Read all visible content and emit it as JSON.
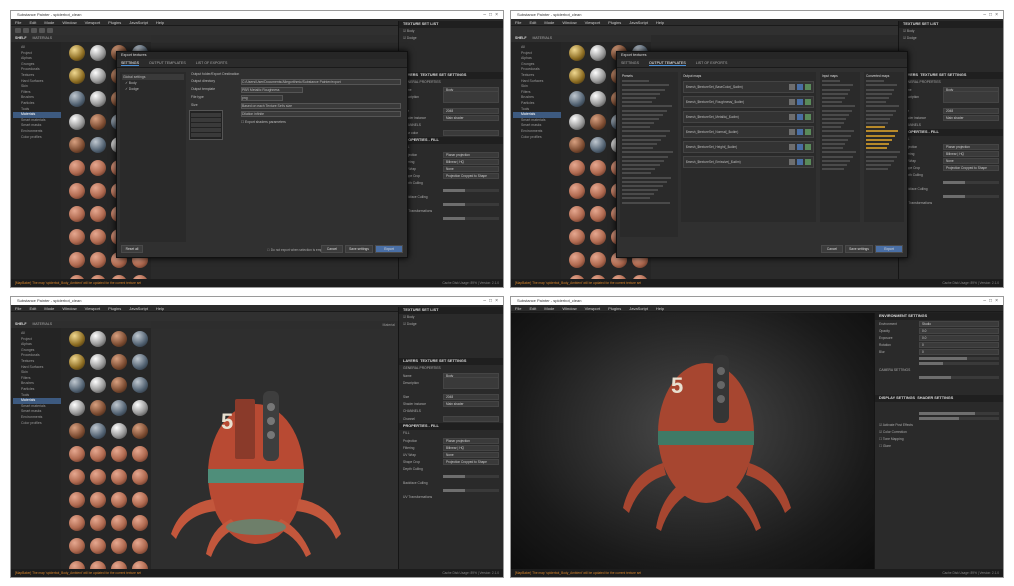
{
  "app": {
    "title": "Substance Painter - spiderbot_clean",
    "menu": [
      "File",
      "Edit",
      "Mode",
      "Window",
      "Viewport",
      "Plugins",
      "JavaScript",
      "Help"
    ]
  },
  "shelf": {
    "tabs": [
      "SHELF",
      "MATERIALS"
    ],
    "categories": [
      "All",
      "Project",
      "Alphas",
      "Grunges",
      "Procedurals",
      "Textures",
      "Hard Surfaces",
      "Skin",
      "Filters",
      "Brushes",
      "Particles",
      "Tools",
      "Materials",
      "Smart materials",
      "Smart masks",
      "Environments",
      "Color profiles"
    ],
    "selected_category": "Materials"
  },
  "viewport": {
    "label": "Material"
  },
  "texture_set_list": {
    "title": "TEXTURE SET LIST",
    "items": [
      "Body",
      "Dodge"
    ]
  },
  "texture_set_settings": {
    "tabs": [
      "LAYERS",
      "TEXTURE SET SETTINGS"
    ],
    "section": "GENERAL PROPERTIES",
    "fields": [
      {
        "label": "Name",
        "value": "Body"
      },
      {
        "label": "Description",
        "value": ""
      },
      {
        "label": "Size",
        "value": "2048"
      },
      {
        "label": "Shader instance",
        "value": "Main shader"
      }
    ],
    "channels_title": "CHANNELS",
    "channels": [
      "Channel",
      "Base color",
      "Height",
      "Roughness",
      "Metallic",
      "Normal"
    ]
  },
  "properties": {
    "title": "PROPERTIES - FILL",
    "fill_title": "FILL",
    "fields": [
      {
        "label": "Projection",
        "value": "Planar projection"
      },
      {
        "label": "Filtering",
        "value": "Bilinear | HQ"
      },
      {
        "label": "UV Wrap",
        "value": "None"
      },
      {
        "label": "Shape Crop",
        "value": "Projection Cropped to Shape"
      }
    ],
    "sections": [
      "Depth Culling",
      "Backface Culling",
      "UV Transformations"
    ]
  },
  "export_dialog": {
    "title": "Export textures",
    "tabs": [
      "SETTINGS",
      "OUTPUT TEMPLATES",
      "LIST OF EXPORTS"
    ],
    "global_settings": "Global settings",
    "subtitle": "Output folder/Export Destination",
    "rows": [
      {
        "label": "Output directory",
        "value": "C:/Users/User/Documents/Allegorithmic/Substance Painter/export"
      },
      {
        "label": "Output template",
        "value": "PBR Metallic Roughness"
      },
      {
        "label": "File type",
        "value": "png"
      },
      {
        "label": "Size",
        "value": "Based on each Texture Set's size"
      },
      {
        "label": "Padding",
        "value": "Dilation infinite"
      }
    ],
    "checkbox_label": "Export shaders parameters",
    "footer_note": "Do not export when selection is empty",
    "buttons": {
      "cancel": "Cancel",
      "save_settings": "Save settings",
      "export": "Export",
      "reset": "Reset all"
    }
  },
  "templates_dialog": {
    "left_title": "Presets",
    "output_maps_title": "Output maps",
    "input_maps_title": "Input maps",
    "converted_maps_title": "Converted maps",
    "map_rows": [
      "$mesh_$textureSet_BaseColor(_$udim)",
      "$mesh_$textureSet_Roughness(_$udim)",
      "$mesh_$textureSet_Metallic(_$udim)",
      "$mesh_$textureSet_Normal(_$udim)",
      "$mesh_$textureSet_Height(_$udim)",
      "$mesh_$textureSet_Emissive(_$udim)"
    ]
  },
  "display_settings": {
    "tabs": [
      "DISPLAY SETTINGS",
      "SHADER SETTINGS"
    ],
    "env_title": "ENVIRONMENT SETTINGS",
    "env_rows": [
      {
        "label": "Environment",
        "value": "Studio"
      },
      {
        "label": "Opacity",
        "value": "0.0"
      },
      {
        "label": "Exposure",
        "value": "0.0"
      },
      {
        "label": "Rotation",
        "value": "0"
      },
      {
        "label": "Blur",
        "value": "0"
      }
    ],
    "camera_title": "CAMERA SETTINGS",
    "checks": [
      "Activate Post Effects",
      "Color Correction",
      "Tone Mapping",
      "Glare"
    ]
  },
  "status": {
    "message": "[MapBaker] The map 'spiderbot_Body_Ambient' will be updated for the current texture set",
    "right": "Cache Disk Usage: 89% | Version: 2.1.0"
  },
  "colors": {
    "robot_body": "#c3573c",
    "robot_stripe": "#4f8e7a",
    "accent_blue": "#3d5a80",
    "status_warning": "#d9852a"
  }
}
